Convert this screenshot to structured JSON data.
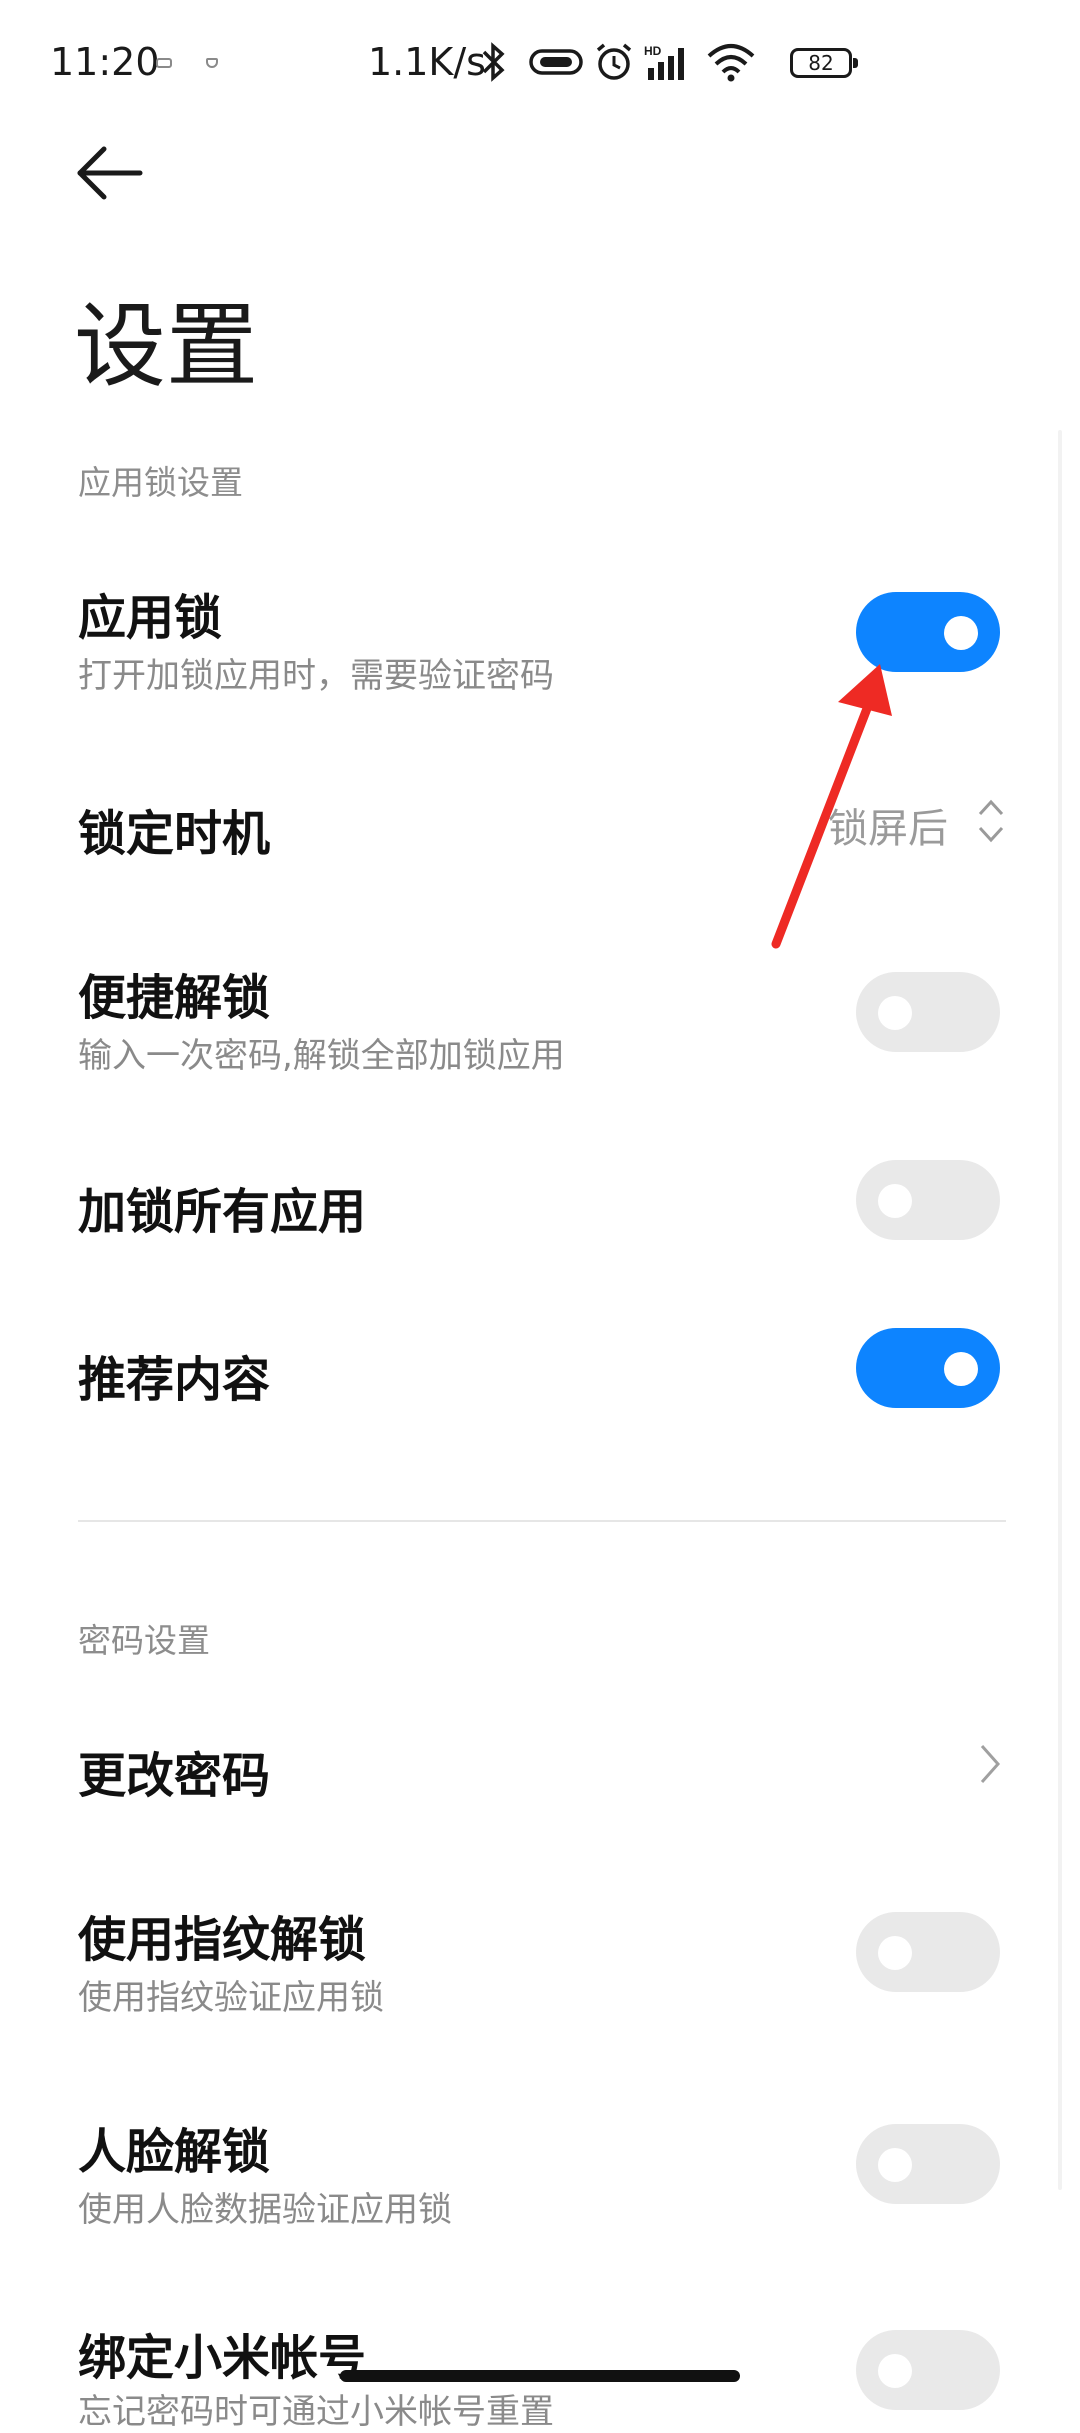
{
  "status": {
    "time": "11:20",
    "network_speed": "1.1K/s",
    "battery": "82"
  },
  "header": {
    "title": "设置"
  },
  "applock_section": {
    "header": "应用锁设置",
    "app_lock": {
      "title": "应用锁",
      "subtitle": "打开加锁应用时，需要验证密码",
      "enabled": true
    },
    "lock_timing": {
      "title": "锁定时机",
      "value": "锁屏后"
    },
    "quick_unlock": {
      "title": "便捷解锁",
      "subtitle": "输入一次密码,解锁全部加锁应用",
      "enabled": false
    },
    "lock_all_apps": {
      "title": "加锁所有应用",
      "enabled": false
    },
    "recommended_content": {
      "title": "推荐内容",
      "enabled": true
    }
  },
  "password_section": {
    "header": "密码设置",
    "change_password": {
      "title": "更改密码"
    },
    "fingerprint_unlock": {
      "title": "使用指纹解锁",
      "subtitle": "使用指纹验证应用锁",
      "enabled": false
    },
    "face_unlock": {
      "title": "人脸解锁",
      "subtitle": "使用人脸数据验证应用锁",
      "enabled": false
    },
    "bind_mi_account": {
      "title": "绑定小米帐号",
      "subtitle": "忘记密码时可通过小米帐号重置",
      "enabled": false
    }
  },
  "colors": {
    "toggle_on": "#0d84ff",
    "toggle_off": "#e9e9e9",
    "annotation_arrow": "#ee2a24"
  }
}
